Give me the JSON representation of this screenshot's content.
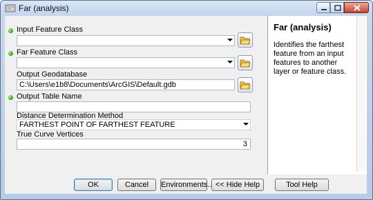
{
  "window": {
    "title": "Far (analysis)"
  },
  "fields": {
    "input_feature_class": {
      "label": "Input Feature Class",
      "value": ""
    },
    "far_feature_class": {
      "label": "Far Feature Class",
      "value": ""
    },
    "output_geodatabase": {
      "label": "Output Geodatabase",
      "value": "C:\\Users\\e1b8\\Documents\\ArcGIS\\Default.gdb"
    },
    "output_table_name": {
      "label": "Output Table Name",
      "value": ""
    },
    "distance_method": {
      "label": "Distance Determination Method",
      "value": "FARTHEST POINT OF FARTHEST FEATURE"
    },
    "true_curve_vertices": {
      "label": "True Curve Vertices",
      "value": "3"
    }
  },
  "help": {
    "title": "Far (analysis)",
    "description": "Identifies the farthest feature from an input features to another layer or feature class."
  },
  "buttons": {
    "ok": "OK",
    "cancel": "Cancel",
    "environments": "Environments...",
    "hide_help": "<< Hide Help",
    "tool_help": "Tool Help"
  },
  "colors": {
    "required_dot": "#3aa51a",
    "title_bar": "#c3d5ee",
    "close_button": "#c7452f"
  },
  "icons": [
    "app-toolbox-icon",
    "required-indicator-icon",
    "browse-folder-icon",
    "dropdown-arrow-icon"
  ]
}
